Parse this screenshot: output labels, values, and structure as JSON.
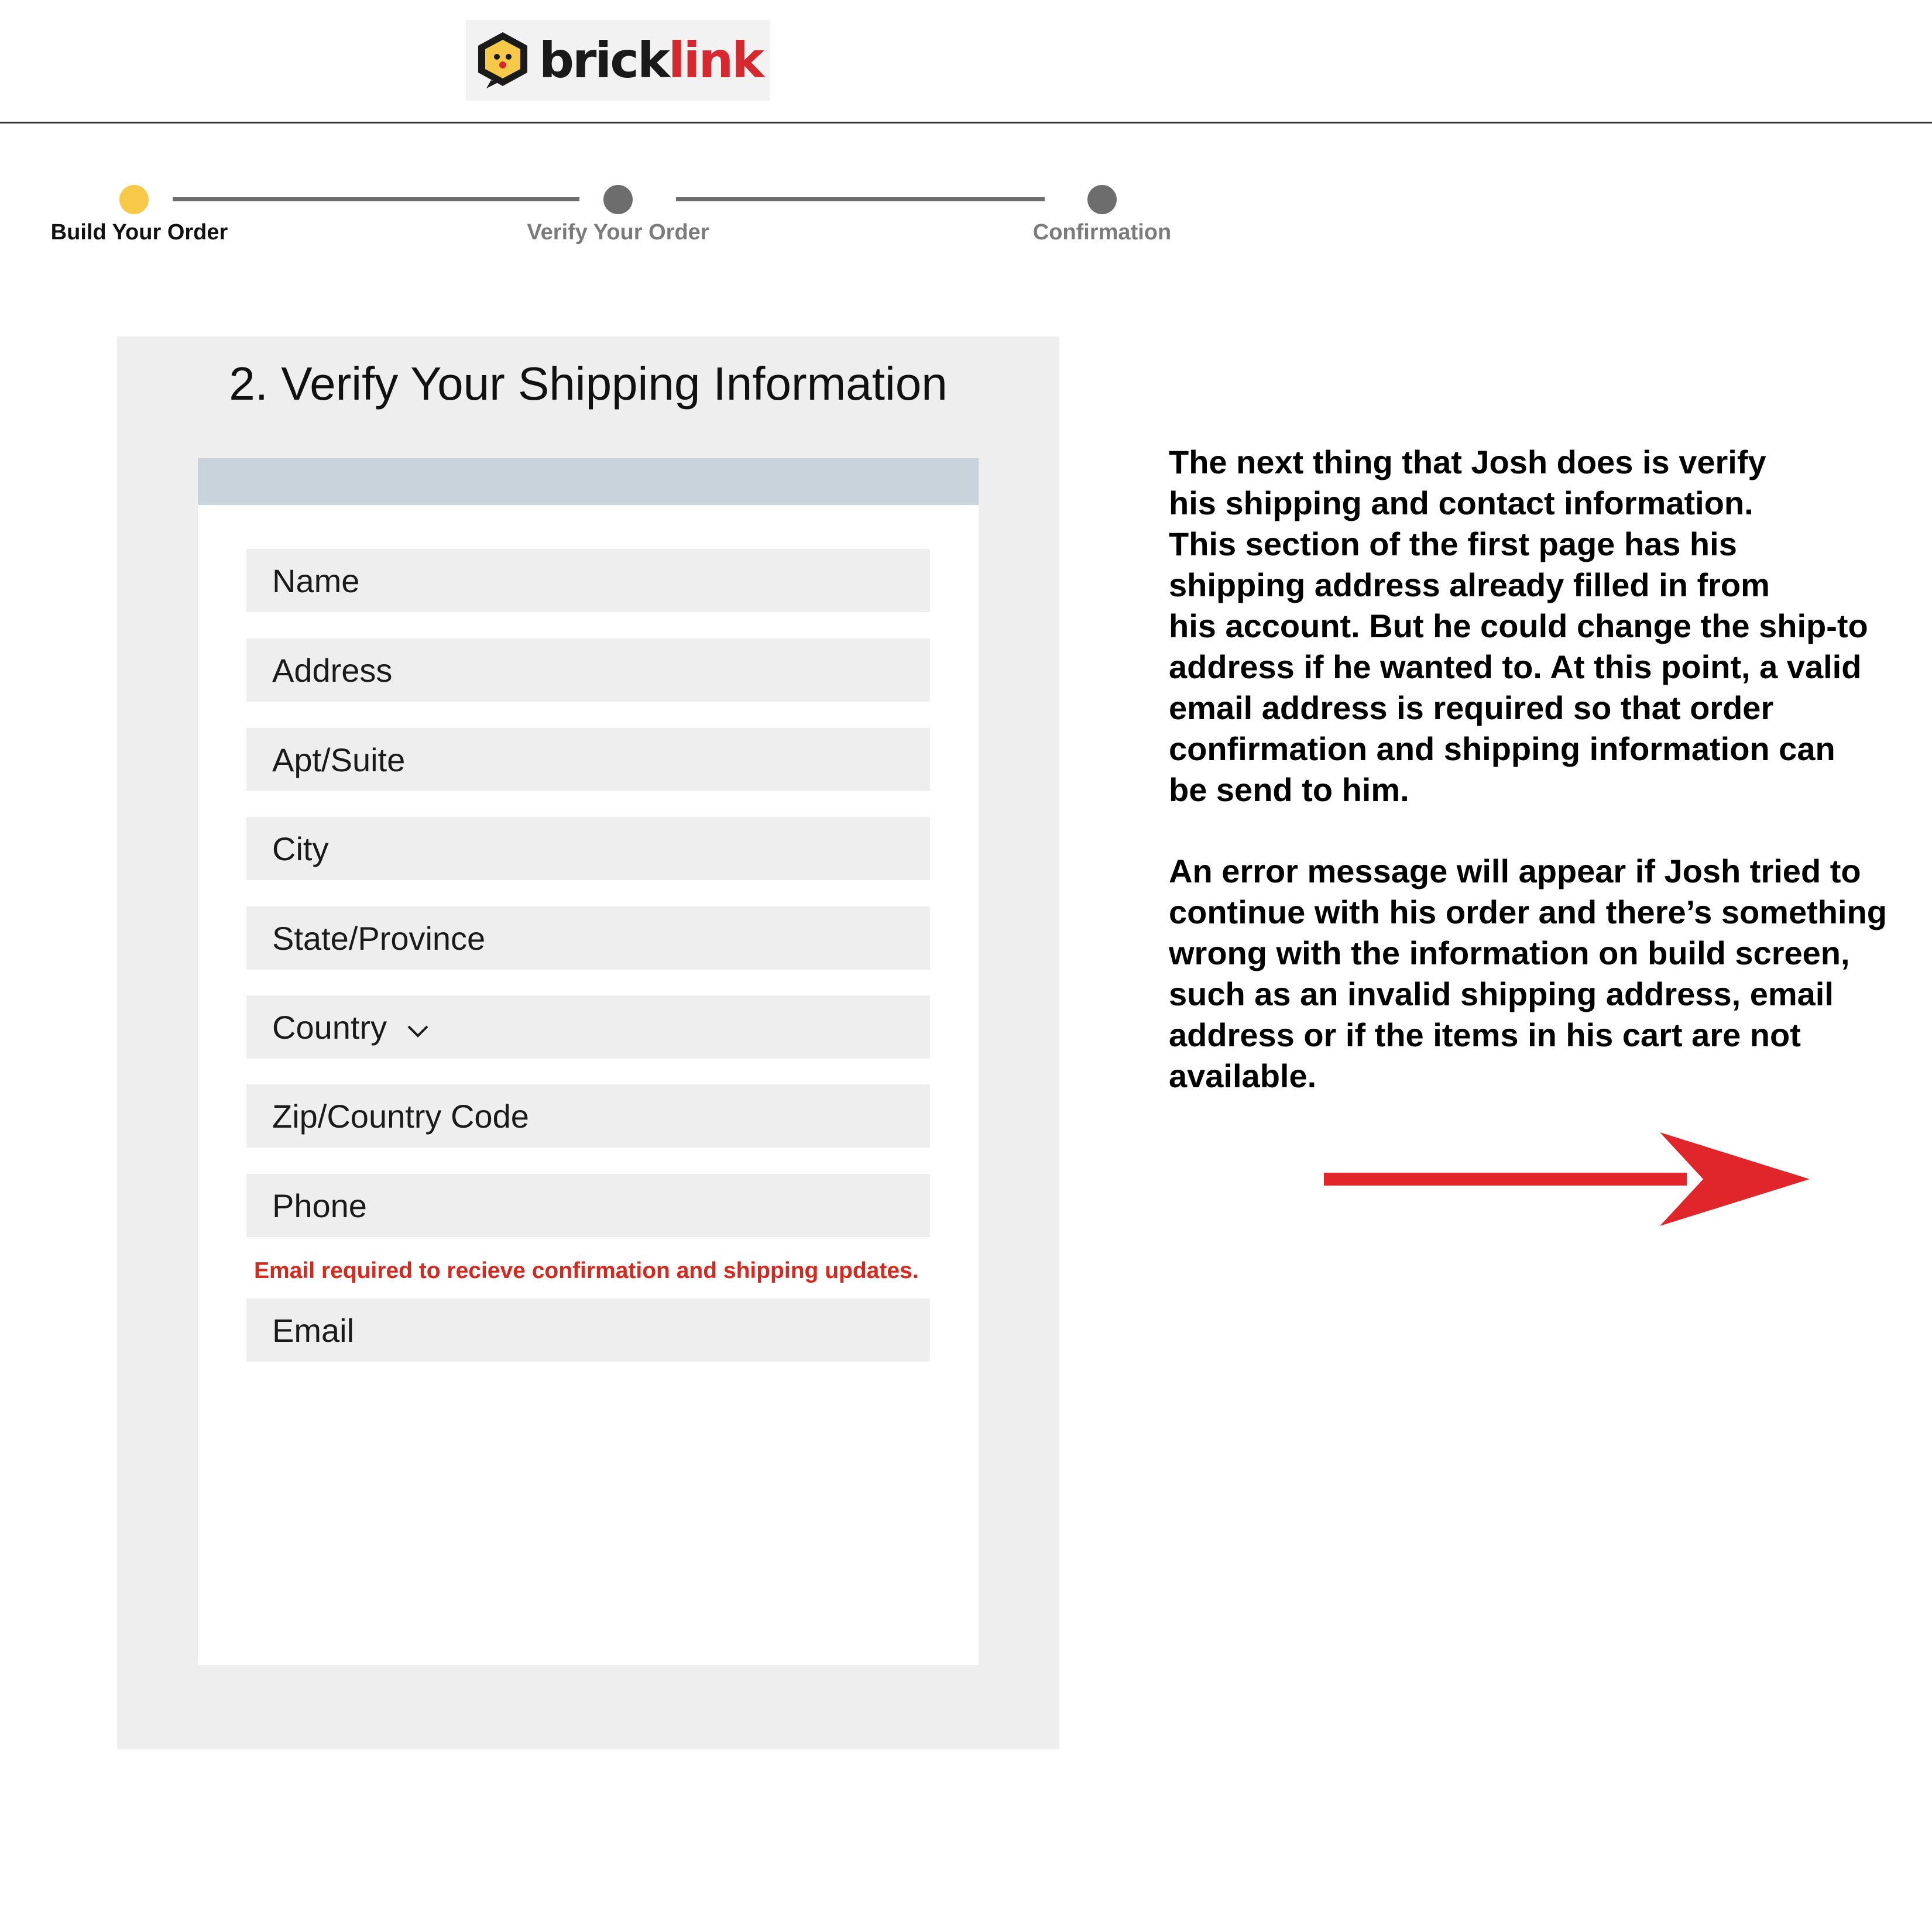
{
  "header": {
    "logo": {
      "brick_text": "brick",
      "link_text": "link"
    }
  },
  "steps": [
    {
      "label": "Build Your Order",
      "state": "active",
      "color": "#f7c948"
    },
    {
      "label": "Verify Your Order",
      "state": "inactive",
      "color": "#6d6d6d"
    },
    {
      "label": "Confirmation",
      "state": "inactive",
      "color": "#6d6d6d"
    }
  ],
  "form": {
    "title": "2. Verify Your Shipping Information",
    "fields": [
      {
        "label": "Name"
      },
      {
        "label": "Address"
      },
      {
        "label": "Apt/Suite"
      },
      {
        "label": "City"
      },
      {
        "label": "State/Province"
      },
      {
        "label": "Country",
        "icon": "chevron-down-icon"
      },
      {
        "label": "Zip/Country Code"
      },
      {
        "label": "Phone"
      },
      {
        "label": "Email"
      }
    ],
    "error_message": "Email required to recieve confirmation and shipping updates.",
    "error_color": "#d5291f"
  },
  "annotation": {
    "paragraph1": [
      "The next thing that Josh does is verify",
      "his shipping and contact information.",
      "This section of the first page has his",
      "shipping address already filled in from",
      "his account. But he could change the ship-to",
      "address if he wanted to.  At this point, a valid",
      "email address is required so that order",
      "confirmation and shipping information can",
      "be send to him."
    ],
    "paragraph2": [
      "An error message will appear if Josh tried to",
      "continue with his order and there’s something",
      "wrong with the information on build screen,",
      "such as an invalid shipping address, email",
      "address or if the items in his cart are not",
      "available."
    ],
    "arrow_icon": "right-arrow-icon",
    "arrow_color": "#e0262b"
  }
}
